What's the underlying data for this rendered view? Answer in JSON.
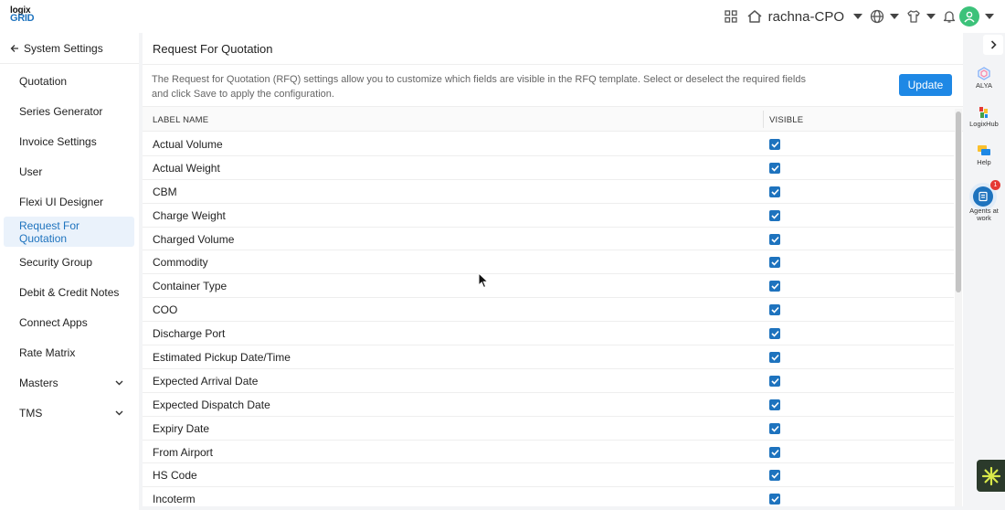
{
  "brand": {
    "logo_top": "logix",
    "logo_bottom": "GRID"
  },
  "topbar": {
    "user": "rachna-CPO"
  },
  "sidebar": {
    "back_label": "System Settings",
    "items": [
      {
        "label": "Quotation"
      },
      {
        "label": "Series Generator"
      },
      {
        "label": "Invoice Settings"
      },
      {
        "label": "User"
      },
      {
        "label": "Flexi UI Designer"
      },
      {
        "label": "Request For Quotation",
        "active": true
      },
      {
        "label": "Security Group"
      },
      {
        "label": "Debit & Credit Notes"
      },
      {
        "label": "Connect Apps"
      },
      {
        "label": "Rate Matrix"
      },
      {
        "label": "Masters",
        "expandable": true
      },
      {
        "label": "TMS",
        "expandable": true
      }
    ]
  },
  "main": {
    "title": "Request For Quotation",
    "description": "The Request for Quotation (RFQ) settings allow you to customize which fields are visible in the RFQ template. Select or deselect the required fields and click Save to apply the configuration.",
    "update_label": "Update",
    "table": {
      "col_label": "LABEL NAME",
      "col_visible": "VISIBLE",
      "rows": [
        {
          "label": "Actual Volume",
          "visible": true
        },
        {
          "label": "Actual Weight",
          "visible": true
        },
        {
          "label": "CBM",
          "visible": true
        },
        {
          "label": "Charge Weight",
          "visible": true
        },
        {
          "label": "Charged Volume",
          "visible": true
        },
        {
          "label": "Commodity",
          "visible": true
        },
        {
          "label": "Container Type",
          "visible": true
        },
        {
          "label": "COO",
          "visible": true
        },
        {
          "label": "Discharge Port",
          "visible": true
        },
        {
          "label": "Estimated Pickup Date/Time",
          "visible": true
        },
        {
          "label": "Expected Arrival Date",
          "visible": true
        },
        {
          "label": "Expected Dispatch Date",
          "visible": true
        },
        {
          "label": "Expiry Date",
          "visible": true
        },
        {
          "label": "From Airport",
          "visible": true
        },
        {
          "label": "HS Code",
          "visible": true
        },
        {
          "label": "Incoterm",
          "visible": true
        }
      ]
    }
  },
  "rail": {
    "alya": "ALYA",
    "logixhub": "LogixHub",
    "help": "Help",
    "agents_line1": "Agents at",
    "agents_line2": "work",
    "agents_badge": "1"
  },
  "colors": {
    "accent": "#1e73be",
    "button": "#1e88e5",
    "active_bg": "#eaf2fb",
    "avatar": "#3cc27a"
  },
  "icons": [
    "grid-icon",
    "home-icon",
    "globe-icon",
    "shirt-icon",
    "bell-icon",
    "user-avatar-icon",
    "arrow-left-icon",
    "chevron-down-icon",
    "chevron-right-icon",
    "checkbox-checked-icon"
  ]
}
